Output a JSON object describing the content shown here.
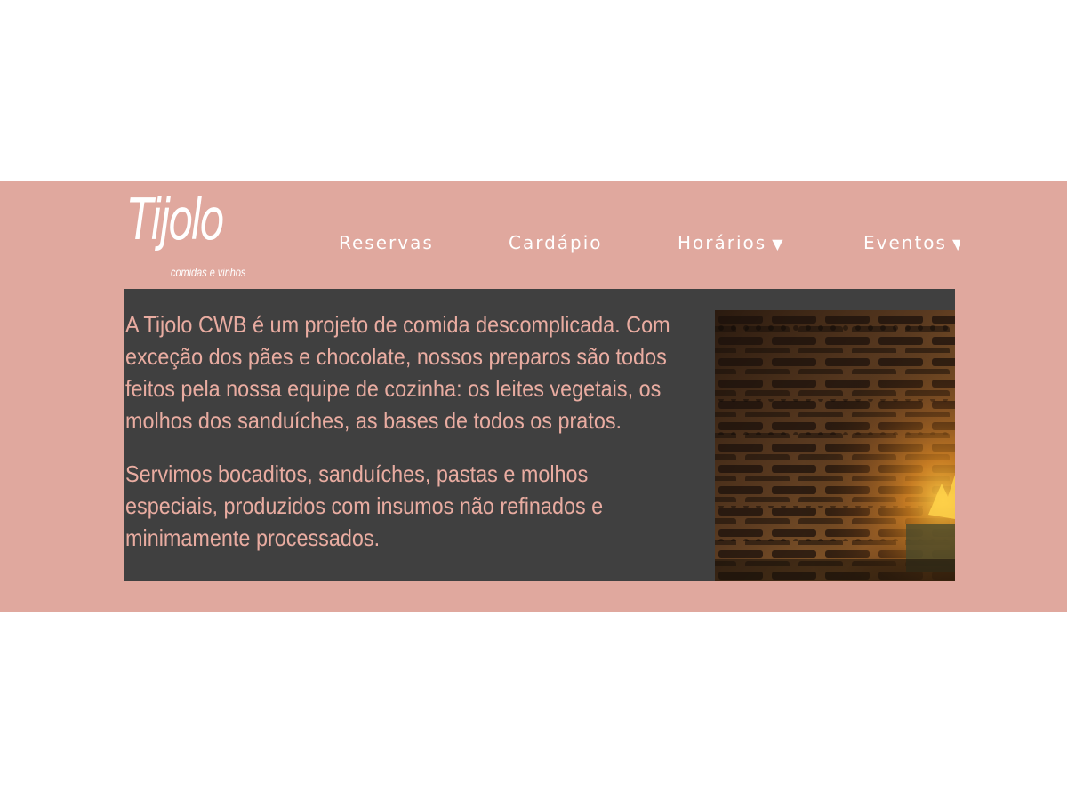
{
  "brand": {
    "name": "Tijolo",
    "tagline": "comidas e vinhos"
  },
  "nav": {
    "items": [
      {
        "label": "Reservas",
        "caret": ""
      },
      {
        "label": "Cardápio",
        "caret": ""
      },
      {
        "label": "Horários",
        "caret": "▼"
      },
      {
        "label": "Eventos",
        "caret": "▼"
      }
    ]
  },
  "content": {
    "paragraphs": [
      "A Tijolo CWB é um projeto de comida descomplicada. Com exceção dos pães e chocolate, nossos preparos são todos feitos pela nossa equipe de cozinha: os leites vegetais, os molhos dos sanduíches, as bases de todos os pratos.",
      "Servimos bocaditos, sanduíches, pastas e molhos especiais, produzidos com insumos não refinados e minimamente processados."
    ]
  },
  "photo": {
    "subject": "brick wall with warm lamp light"
  },
  "colors": {
    "band_bg": "#e0a89e",
    "panel_bg": "#404040",
    "text": "#e9aca1",
    "nav_text": "#ffffff"
  }
}
